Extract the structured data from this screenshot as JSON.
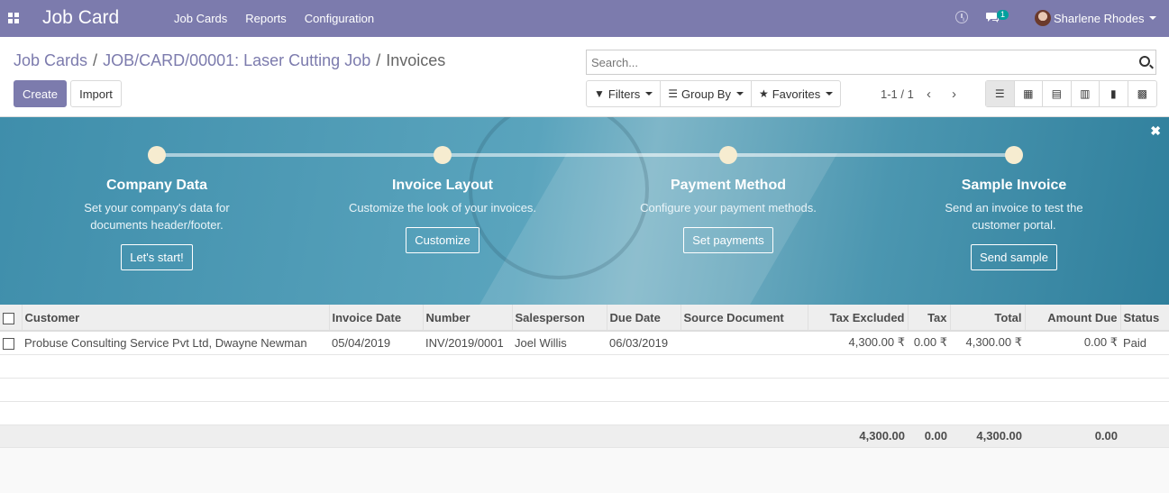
{
  "app": {
    "title": "Job Card"
  },
  "menu": [
    "Job Cards",
    "Reports",
    "Configuration"
  ],
  "user": {
    "name": "Sharlene Rhodes",
    "message_count": "1"
  },
  "breadcrumb": {
    "items": [
      "Job Cards",
      "JOB/CARD/00001: Laser Cutting Job"
    ],
    "separator": "/",
    "current": "Invoices"
  },
  "buttons": {
    "create": "Create",
    "import": "Import"
  },
  "search": {
    "placeholder": "Search..."
  },
  "filters": {
    "filters": "Filters",
    "group_by": "Group By",
    "favorites": "Favorites"
  },
  "pager": {
    "text": "1-1 / 1"
  },
  "banner": {
    "steps": [
      {
        "title": "Company Data",
        "description": "Set your company's data for documents header/footer.",
        "button": "Let's start!"
      },
      {
        "title": "Invoice Layout",
        "description": "Customize the look of your invoices.",
        "button": "Customize"
      },
      {
        "title": "Payment Method",
        "description": "Configure your payment methods.",
        "button": "Set payments"
      },
      {
        "title": "Sample Invoice",
        "description": "Send an invoice to test the customer portal.",
        "button": "Send sample"
      }
    ]
  },
  "table": {
    "columns": [
      "Customer",
      "Invoice Date",
      "Number",
      "Salesperson",
      "Due Date",
      "Source Document",
      "Tax Excluded",
      "Tax",
      "Total",
      "Amount Due",
      "Status"
    ],
    "rows": [
      {
        "customer": "Probuse Consulting Service Pvt Ltd, Dwayne Newman",
        "invoice_date": "05/04/2019",
        "number": "INV/2019/0001",
        "salesperson": "Joel Willis",
        "due_date": "06/03/2019",
        "source_document": "",
        "tax_excluded": "4,300.00 ₹",
        "tax": "0.00 ₹",
        "total": "4,300.00 ₹",
        "amount_due": "0.00 ₹",
        "status": "Paid"
      }
    ],
    "totals": {
      "tax_excluded": "4,300.00",
      "tax": "0.00",
      "total": "4,300.00",
      "amount_due": "0.00"
    }
  },
  "colors": {
    "brand": "#7c7bad",
    "banner": "#4b96b0",
    "accent_badge": "#00a09d"
  }
}
